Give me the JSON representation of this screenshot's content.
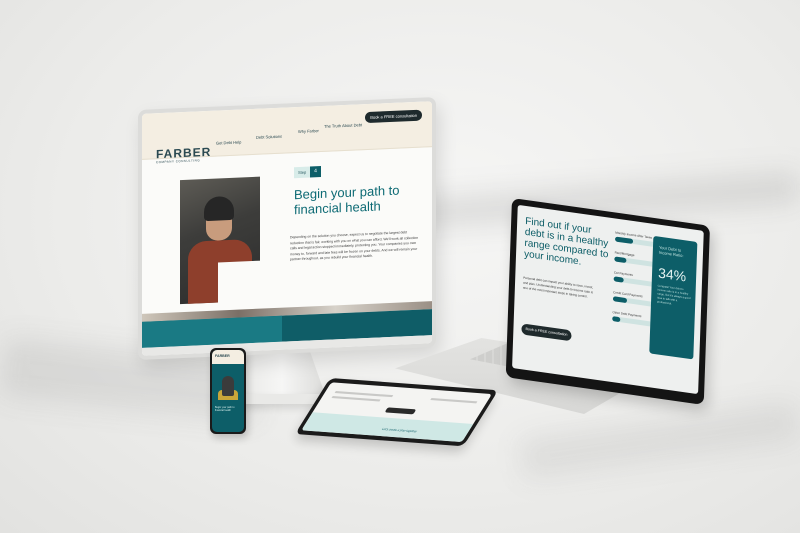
{
  "colors": {
    "brand_teal": "#0d5e68",
    "cream": "#f4eee2",
    "dark": "#1e2a2d",
    "background": "#ececea"
  },
  "desktop": {
    "logo": "FARBER",
    "logo_tagline": "COMPANY CONSULTING",
    "nav": {
      "items": [
        "Get Debt Help",
        "Debt Solutions",
        "Why Farber",
        "The Truth About Debt"
      ],
      "cta": "Book a FREE consultation"
    },
    "step_label": "Step",
    "step_number": "4",
    "hero_title": "Begin your path to financial health",
    "hero_body": "Depending on the solution you choose, expect us to negotiate the largest debt reduction that is fair, working with you on what you can afford. We'll work all collection calls and legal action stopped immediately, protecting you. Your companies you owe money to, forward and late fees will be frozen on your debts. And we will remain your partner throughout, as you rebuild your financial health."
  },
  "laptop": {
    "title": "Find out if your debt is in a healthy range compared to your income.",
    "body": "Personal debt can impact your ability to save, invest, and plan. Understanding your debt-to-income ratio is one of the most important steps in taking control.",
    "cta": "Book a FREE consultation",
    "sliders": [
      {
        "label": "Monthly Income After Taxes",
        "fill": 0.45
      },
      {
        "label": "Rent/Mortgage",
        "fill": 0.3
      },
      {
        "label": "Car Payments",
        "fill": 0.25
      },
      {
        "label": "Credit Card Payments",
        "fill": 0.35
      },
      {
        "label": "Other Debt Payments",
        "fill": 0.2
      }
    ],
    "ratio": {
      "title": "Your Debt to Income Ratio:",
      "value": "34%",
      "note": "Congrats! Your debt to income ratio is in a healthy range. But it's always a good idea to talk with a professional."
    }
  },
  "tablet": {
    "footer_text": "Let's create a plan together"
  },
  "phone": {
    "logo": "FARBER",
    "text": "Begin your path to financial health"
  }
}
